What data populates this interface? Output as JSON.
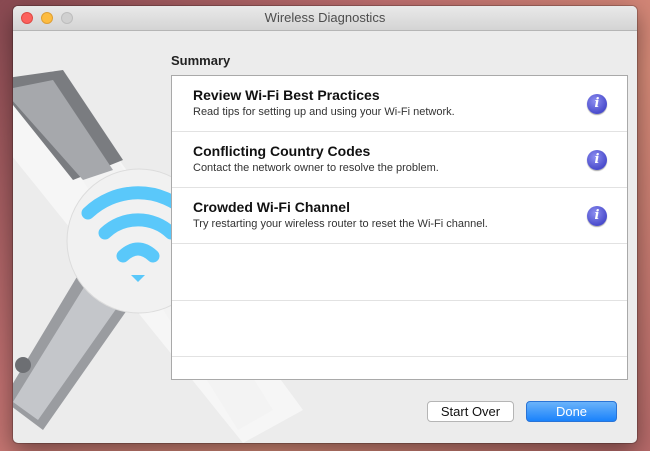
{
  "window": {
    "title": "Wireless Diagnostics"
  },
  "summary": {
    "label": "Summary",
    "items": [
      {
        "title": "Review Wi-Fi Best Practices",
        "description": "Read tips for setting up and using your Wi-Fi network.",
        "icon": "info-icon"
      },
      {
        "title": "Conflicting Country Codes",
        "description": "Contact the network owner to resolve the problem.",
        "icon": "info-icon"
      },
      {
        "title": "Crowded Wi-Fi Channel",
        "description": "Try restarting your wireless router to reset the Wi-Fi channel.",
        "icon": "info-icon"
      }
    ]
  },
  "buttons": {
    "start_over": "Start Over",
    "done": "Done"
  },
  "icons": {
    "info_glyph": "i"
  },
  "colors": {
    "accent": "#1a82fb",
    "info": "#5557d6",
    "wifi": "#5ac8fa"
  }
}
